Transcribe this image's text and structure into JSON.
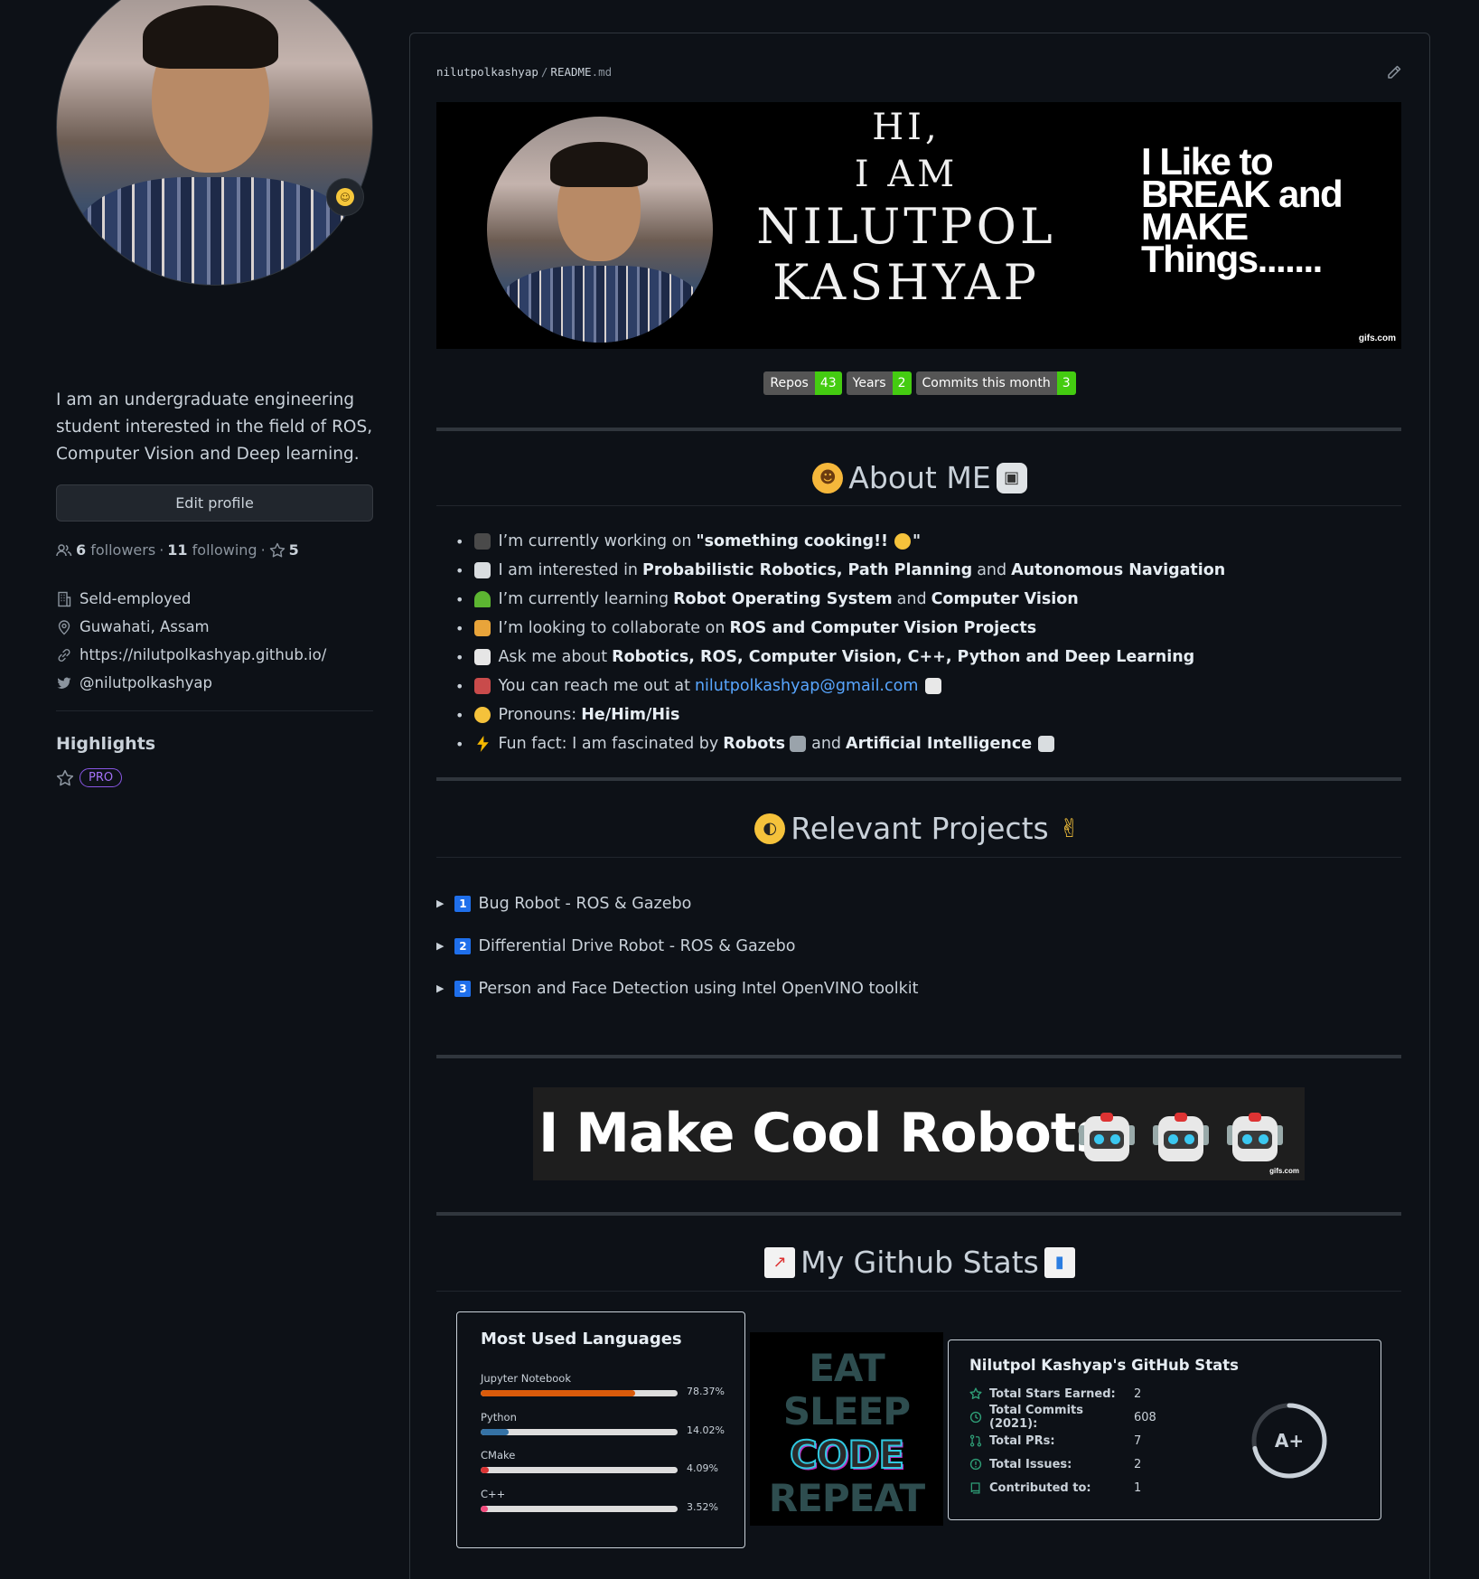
{
  "sidebar": {
    "bio": "I am an undergraduate engineering student interested in the field of ROS, Computer Vision and Deep learning.",
    "edit_profile": "Edit profile",
    "followers_count": "6",
    "followers_label": "followers",
    "following_count": "11",
    "following_label": "following",
    "stars_count": "5",
    "company": "Seld-employed",
    "location": "Guwahati, Assam",
    "website": "https://nilutpolkashyap.github.io/",
    "twitter": "@nilutpolkashyap",
    "highlights_title": "Highlights",
    "pro_badge": "PRO"
  },
  "readme": {
    "owner": "nilutpolkashyap",
    "file": "README",
    "ext": ".md",
    "banner": {
      "hi": "HI,",
      "iam": "I AM",
      "first": "NILUTPOL",
      "last": "KASHYAP",
      "tagline": [
        "I Like to",
        "BREAK and",
        "MAKE",
        "Things......."
      ],
      "watermark": "gifs.com"
    },
    "badges": [
      {
        "label": "Repos",
        "value": "43"
      },
      {
        "label": "Years",
        "value": "2"
      },
      {
        "label": "Commits this month",
        "value": "3"
      }
    ],
    "about_title": "About ME",
    "about_items": {
      "working_pre": "I’m currently working on",
      "working_bold": "\"something cooking!!",
      "working_post": "\"",
      "interested_pre": "I am interested in",
      "interested_b1": "Probabilistic Robotics, Path Planning",
      "interested_and": "and",
      "interested_b2": "Autonomous Navigation",
      "learning_pre": "I’m currently learning",
      "learning_b1": "Robot Operating System",
      "learning_and": "and",
      "learning_b2": "Computer Vision",
      "collab_pre": "I’m looking to collaborate on",
      "collab_b": "ROS and Computer Vision Projects",
      "ask_pre": "Ask me about",
      "ask_b": "Robotics, ROS, Computer Vision, C++, Python and Deep Learning",
      "reach_pre": "You can reach me out at",
      "reach_email": "nilutpolkashyap@gmail.com",
      "pronouns_pre": "Pronouns:",
      "pronouns_b": "He/Him/His",
      "fun_pre": "Fun fact: I am fascinated by",
      "fun_b1": "Robots",
      "fun_and": "and",
      "fun_b2": "Artificial Intelligence"
    },
    "projects_title": "Relevant Projects",
    "projects": [
      {
        "num": "1",
        "title": "Bug Robot - ROS & Gazebo"
      },
      {
        "num": "2",
        "title": "Differential Drive Robot - ROS & Gazebo"
      },
      {
        "num": "3",
        "title": "Person and Face Detection using Intel OpenVINO toolkit"
      }
    ],
    "robots_banner": "I Make Cool Robots",
    "robots_watermark": "gifs.com",
    "stats_title": "My Github Stats",
    "languages_card": {
      "title": "Most Used Languages",
      "items": [
        {
          "name": "Jupyter Notebook",
          "pct": "78.37%",
          "value": 78.37,
          "color": "#DA5B0B"
        },
        {
          "name": "Python",
          "pct": "14.02%",
          "value": 14.02,
          "color": "#3572A5"
        },
        {
          "name": "CMake",
          "pct": "4.09%",
          "value": 4.09,
          "color": "#DA3434"
        },
        {
          "name": "C++",
          "pct": "3.52%",
          "value": 3.52,
          "color": "#f34b7d"
        }
      ]
    },
    "eat_card": [
      "EAT",
      "SLEEP",
      "CODE",
      "REPEAT"
    ],
    "stats_card": {
      "title": "Nilutpol Kashyap's GitHub Stats",
      "rows": [
        {
          "label": "Total Stars Earned:",
          "value": "2",
          "icon": "star-icon"
        },
        {
          "label": "Total Commits (2021):",
          "value": "608",
          "icon": "history-icon"
        },
        {
          "label": "Total PRs:",
          "value": "7",
          "icon": "pull-request-icon"
        },
        {
          "label": "Total Issues:",
          "value": "2",
          "icon": "issue-icon"
        },
        {
          "label": "Contributed to:",
          "value": "1",
          "icon": "repo-icon"
        }
      ],
      "grade": "A+",
      "accent": "#2f9e77"
    }
  }
}
